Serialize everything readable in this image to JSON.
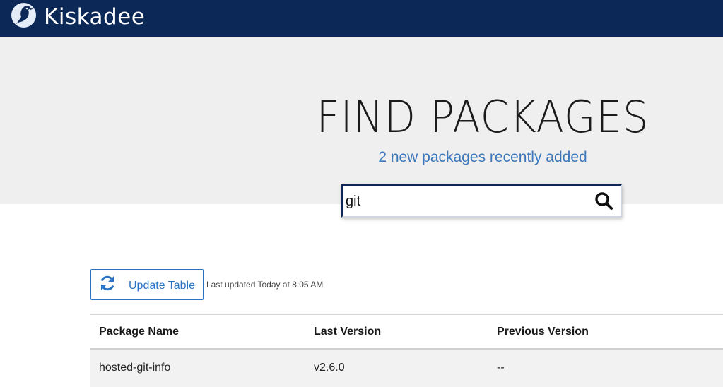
{
  "header": {
    "brand": "Kiskadee"
  },
  "hero": {
    "title": "FIND PACKAGES",
    "subtitle": "2 new packages recently added",
    "search_value": "git"
  },
  "toolbar": {
    "update_label": "Update Table",
    "last_updated": "Last updated Today at 8:05 AM"
  },
  "table": {
    "columns": [
      "Package Name",
      "Last Version",
      "Previous Version"
    ],
    "rows": [
      [
        "hosted-git-info",
        "v2.6.0",
        "--"
      ]
    ]
  },
  "colors": {
    "nav_bg": "#0c2856",
    "accent": "#2a73c2",
    "subtitle": "#3a77bb",
    "hero_bg": "#efefef"
  },
  "icons": [
    "kiskadee-bird-icon",
    "search-icon",
    "refresh-icon"
  ]
}
